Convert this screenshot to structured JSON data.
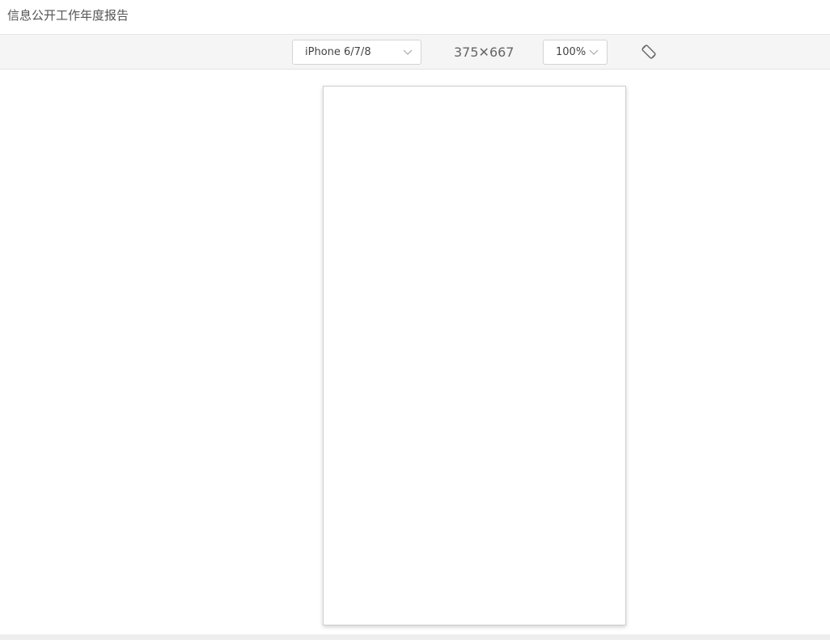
{
  "window": {
    "title": "信息公开工作年度报告"
  },
  "toolbar": {
    "device_select": {
      "selected": "iPhone 6/7/8",
      "icon": "chevron-down-icon"
    },
    "dimensions_text": "375✕667",
    "zoom_select": {
      "selected": "100%",
      "icon": "chevron-down-icon"
    },
    "rotate_icon": "rotate-device-icon"
  },
  "colors": {
    "toolbar_background": "#f5f5f5",
    "text": "#555555",
    "border": "#d4d4d4"
  }
}
